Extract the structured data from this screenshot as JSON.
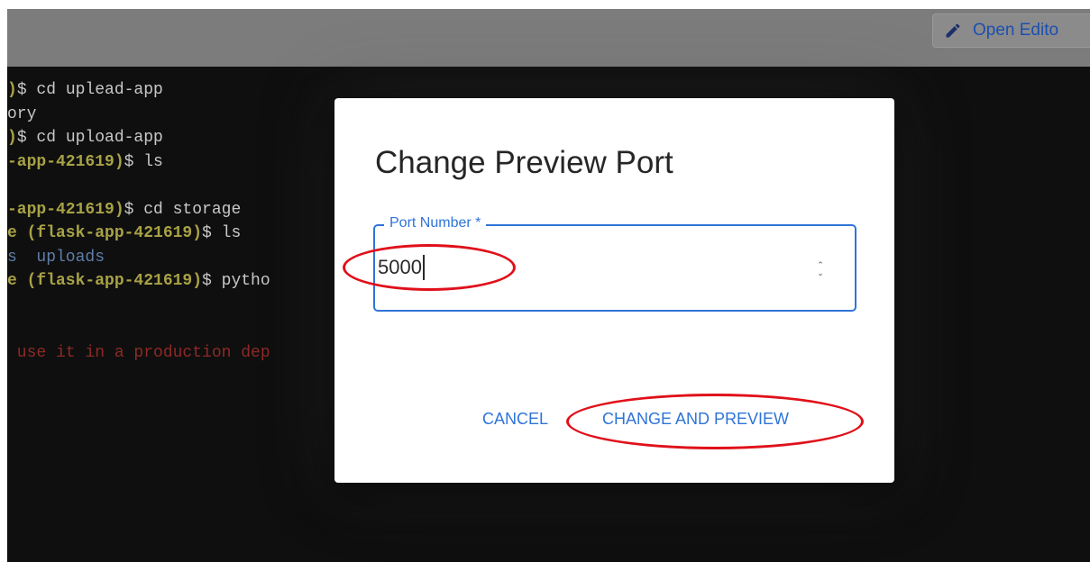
{
  "toolbar": {
    "open_editor_label": "Open Edito"
  },
  "terminal": {
    "lines": [
      [
        {
          "text": ")",
          "style": "t-yellow"
        },
        {
          "text": "$ cd uplead-app",
          "style": "t-plain"
        }
      ],
      [
        {
          "text": "ory",
          "style": "t-plain"
        }
      ],
      [
        {
          "text": ")",
          "style": "t-yellow"
        },
        {
          "text": "$ cd upload-app",
          "style": "t-plain"
        }
      ],
      [
        {
          "text": "-app-421619)",
          "style": "t-yellow"
        },
        {
          "text": "$ ls",
          "style": "t-plain"
        }
      ],
      [
        {
          "text": "",
          "style": "t-plain"
        }
      ],
      [
        {
          "text": "-app-421619)",
          "style": "t-yellow"
        },
        {
          "text": "$ cd storage",
          "style": "t-plain"
        }
      ],
      [
        {
          "text": "e (flask-app-421619)",
          "style": "t-yellow"
        },
        {
          "text": "$ ls",
          "style": "t-plain"
        }
      ],
      [
        {
          "text": "s  uploads",
          "style": "t-blue"
        }
      ],
      [
        {
          "text": "e (flask-app-421619)",
          "style": "t-yellow"
        },
        {
          "text": "$ pytho",
          "style": "t-plain"
        }
      ],
      [
        {
          "text": "",
          "style": "t-plain"
        }
      ],
      [
        {
          "text": "",
          "style": "t-plain"
        }
      ],
      [
        {
          "text": " use it in a production dep                                         d.",
          "style": "t-red"
        }
      ]
    ]
  },
  "dialog": {
    "title": "Change Preview Port",
    "port_field": {
      "label": "Port Number *",
      "value": "5000"
    },
    "cancel_label": "CANCEL",
    "confirm_label": "CHANGE AND PREVIEW"
  },
  "colors": {
    "accent": "#2f74d8",
    "annotation": "#e0101a",
    "terminal_bg": "#0f0f0f"
  }
}
